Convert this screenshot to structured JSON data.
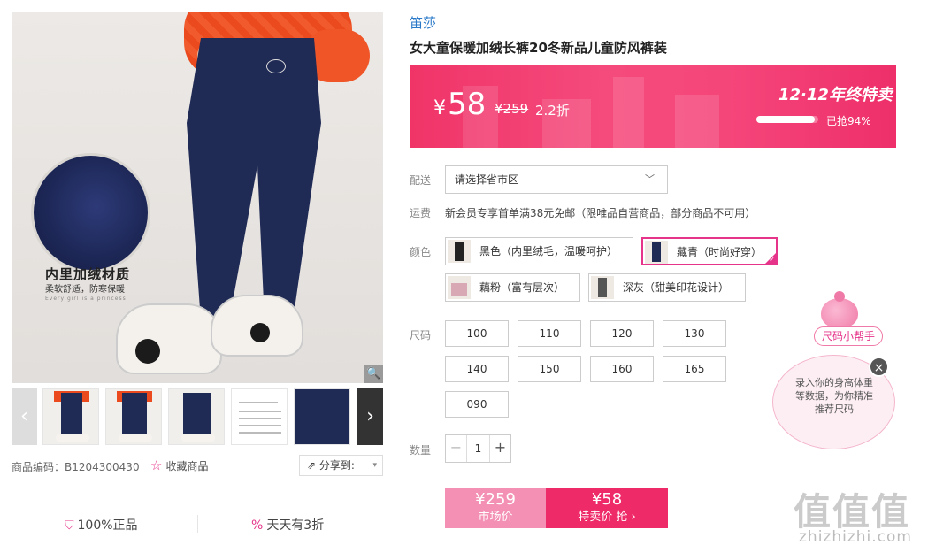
{
  "gallery": {
    "material_title": "内里加绒材质",
    "material_subtitle": "柔软舒适，防寒保暖",
    "material_english": "Every girl is a princess",
    "zoom_icon": "magnifier-icon",
    "prev_icon": "chevron-left-icon",
    "next_icon": "chevron-right-icon"
  },
  "product_meta": {
    "code": "商品编码：B1204300430",
    "favorite_label": "收藏商品",
    "share_label": "分享到:"
  },
  "guarantees": {
    "authentic": "100%正品",
    "discount": "天天有3折"
  },
  "product": {
    "brand": "笛莎",
    "title": "女大童保暖加绒长裤20冬新品儿童防风裤装"
  },
  "price": {
    "currency": "¥",
    "sale": "58",
    "original": "¥259",
    "discount": "2.2折",
    "promo_title": "12·12年终特卖",
    "sold_fraction": 0.94,
    "sold_label": "已抢94%"
  },
  "delivery": {
    "label": "配送",
    "select_value": "请选择省市区"
  },
  "shipping": {
    "label": "运费",
    "text": "新会员专享首单满38元免邮（限唯品自营商品，部分商品不可用）"
  },
  "colors": {
    "label": "颜色",
    "options": [
      {
        "name": "黑色（内里绒毛，温暖呵护）",
        "selected": false
      },
      {
        "name": "藏青（时尚好穿）",
        "selected": true
      },
      {
        "name": "藕粉（富有层次）",
        "selected": false
      },
      {
        "name": "深灰（甜美印花设计）",
        "selected": false
      }
    ],
    "selected_color": "#e6348a"
  },
  "sizes": {
    "label": "尺码",
    "options": [
      "100",
      "110",
      "120",
      "130",
      "140",
      "150",
      "160",
      "165",
      "090"
    ]
  },
  "quantity": {
    "label": "数量",
    "value": "1",
    "minus": "−",
    "plus": "+"
  },
  "buy": {
    "market_price": "¥259",
    "market_label": "市场价",
    "sale_price": "¥58",
    "sale_label": "特卖价 抢 ›"
  },
  "size_helper": {
    "title": "尺码小帮手",
    "text": "录入你的身高体重等数据，为你精准推荐尺码",
    "close": "×"
  },
  "watermark": {
    "main": "值值值",
    "sub": "zhizhizhi.com"
  }
}
